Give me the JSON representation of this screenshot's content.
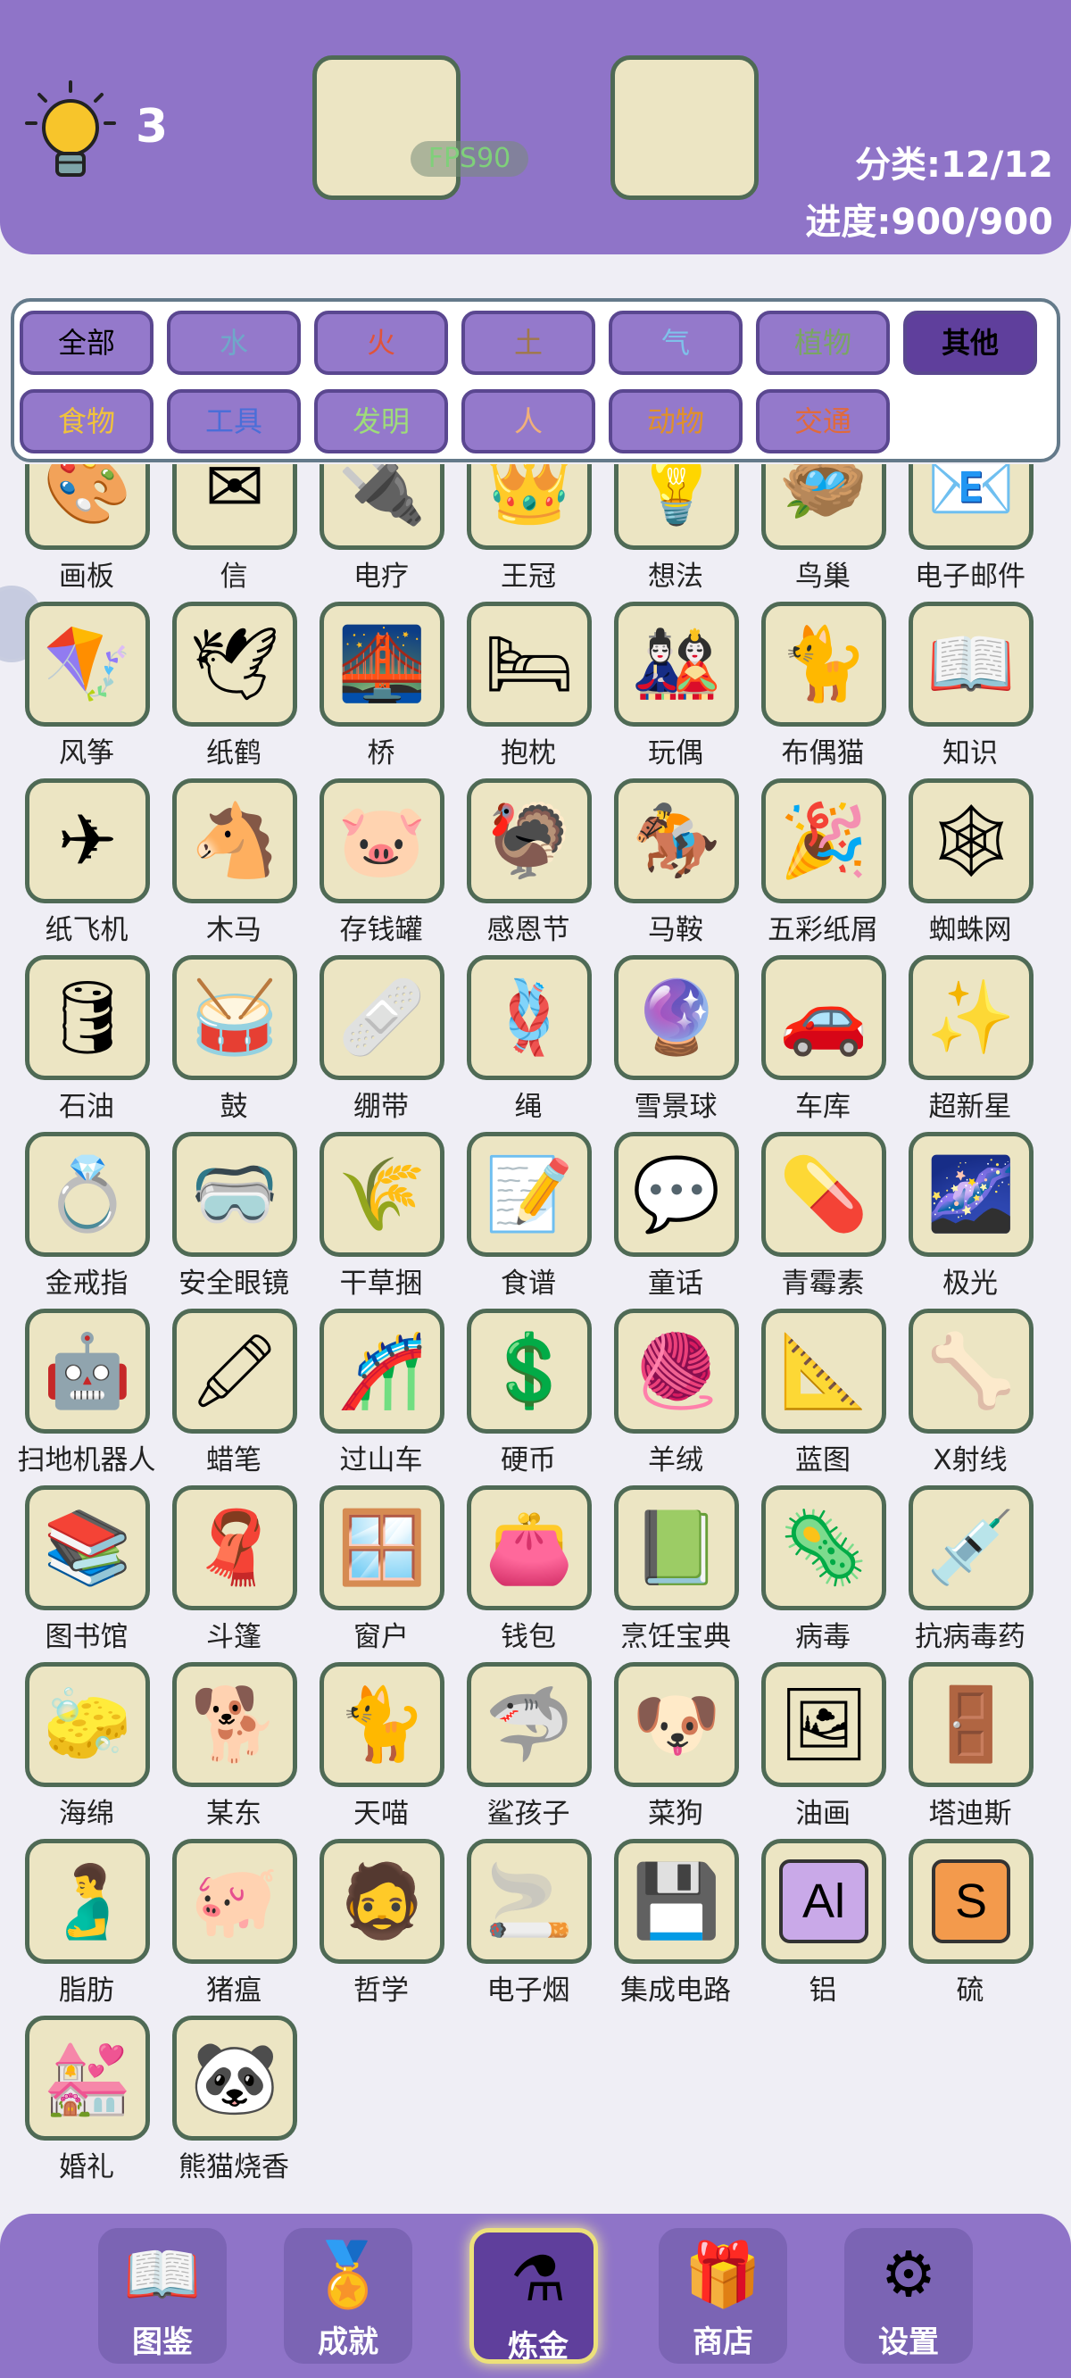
{
  "header": {
    "hint_count": "3",
    "fps": "FPS90",
    "category_stat": "分类:12/12",
    "progress_stat": "进度:900/900"
  },
  "filters": [
    {
      "label": "全部",
      "color": "#000000"
    },
    {
      "label": "水",
      "color": "#6fa8c9"
    },
    {
      "label": "火",
      "color": "#e0533a"
    },
    {
      "label": "土",
      "color": "#a0784a"
    },
    {
      "label": "气",
      "color": "#7fc1ea"
    },
    {
      "label": "植物",
      "color": "#7aa564"
    },
    {
      "label": "其他",
      "color": "#000000",
      "selected": true
    },
    {
      "label": "食物",
      "color": "#f0c23c"
    },
    {
      "label": "工具",
      "color": "#4a6ed8"
    },
    {
      "label": "发明",
      "color": "#9fdc7a"
    },
    {
      "label": "人",
      "color": "#f0b07a"
    },
    {
      "label": "动物",
      "color": "#e0902a"
    },
    {
      "label": "交通",
      "color": "#e06a3c"
    }
  ],
  "items": [
    {
      "name": "画板",
      "icon": "🎨"
    },
    {
      "name": "信",
      "icon": "✉"
    },
    {
      "name": "电疗",
      "icon": "🔌"
    },
    {
      "name": "王冠",
      "icon": "👑"
    },
    {
      "name": "想法",
      "icon": "💡"
    },
    {
      "name": "鸟巢",
      "icon": "🪺"
    },
    {
      "name": "电子邮件",
      "icon": "📧"
    },
    {
      "name": "风筝",
      "icon": "🪁"
    },
    {
      "name": "纸鹤",
      "icon": "🕊"
    },
    {
      "name": "桥",
      "icon": "🌉"
    },
    {
      "name": "抱枕",
      "icon": "🛏"
    },
    {
      "name": "玩偶",
      "icon": "🎎"
    },
    {
      "name": "布偶猫",
      "icon": "🐈"
    },
    {
      "name": "知识",
      "icon": "📖"
    },
    {
      "name": "纸飞机",
      "icon": "✈"
    },
    {
      "name": "木马",
      "icon": "🐴"
    },
    {
      "name": "存钱罐",
      "icon": "🐷"
    },
    {
      "name": "感恩节",
      "icon": "🦃"
    },
    {
      "name": "马鞍",
      "icon": "🏇"
    },
    {
      "name": "五彩纸屑",
      "icon": "🎉"
    },
    {
      "name": "蜘蛛网",
      "icon": "🕸"
    },
    {
      "name": "石油",
      "icon": "🛢"
    },
    {
      "name": "鼓",
      "icon": "🥁"
    },
    {
      "name": "绷带",
      "icon": "🩹"
    },
    {
      "name": "绳",
      "icon": "🪢"
    },
    {
      "name": "雪景球",
      "icon": "🔮"
    },
    {
      "name": "车库",
      "icon": "🚗"
    },
    {
      "name": "超新星",
      "icon": "✨"
    },
    {
      "name": "金戒指",
      "icon": "💍"
    },
    {
      "name": "安全眼镜",
      "icon": "🥽"
    },
    {
      "name": "干草捆",
      "icon": "🌾"
    },
    {
      "name": "食谱",
      "icon": "📝"
    },
    {
      "name": "童话",
      "icon": "💬"
    },
    {
      "name": "青霉素",
      "icon": "💊"
    },
    {
      "name": "极光",
      "icon": "🌌"
    },
    {
      "name": "扫地机器人",
      "icon": "🤖"
    },
    {
      "name": "蜡笔",
      "icon": "🖍"
    },
    {
      "name": "过山车",
      "icon": "🎢"
    },
    {
      "name": "硬币",
      "icon": "💲"
    },
    {
      "name": "羊绒",
      "icon": "🧶"
    },
    {
      "name": "蓝图",
      "icon": "📐"
    },
    {
      "name": "X射线",
      "icon": "🦴"
    },
    {
      "name": "图书馆",
      "icon": "📚"
    },
    {
      "name": "斗篷",
      "icon": "🧣"
    },
    {
      "name": "窗户",
      "icon": "🪟"
    },
    {
      "name": "钱包",
      "icon": "👛"
    },
    {
      "name": "烹饪宝典",
      "icon": "📗"
    },
    {
      "name": "病毒",
      "icon": "🦠"
    },
    {
      "name": "抗病毒药",
      "icon": "💉"
    },
    {
      "name": "海绵",
      "icon": "🧽"
    },
    {
      "name": "某东",
      "icon": "🐕"
    },
    {
      "name": "天喵",
      "icon": "🐈"
    },
    {
      "name": "鲨孩子",
      "icon": "🦈"
    },
    {
      "name": "菜狗",
      "icon": "🐶"
    },
    {
      "name": "油画",
      "icon": "🖼"
    },
    {
      "name": "塔迪斯",
      "icon": "🚪"
    },
    {
      "name": "脂肪",
      "icon": "🫃"
    },
    {
      "name": "猪瘟",
      "icon": "🐖"
    },
    {
      "name": "哲学",
      "icon": "🧔"
    },
    {
      "name": "电子烟",
      "icon": "🚬"
    },
    {
      "name": "集成电路",
      "icon": "💾"
    },
    {
      "name": "铝",
      "icon": "Al"
    },
    {
      "name": "硫",
      "icon": "S"
    },
    {
      "name": "婚礼",
      "icon": "💒"
    },
    {
      "name": "熊猫烧香",
      "icon": "🐼"
    }
  ],
  "nav": [
    {
      "label": "图鉴",
      "icon": "📖"
    },
    {
      "label": "成就",
      "icon": "🏅"
    },
    {
      "label": "炼金",
      "icon": "⚗",
      "active": true
    },
    {
      "label": "商店",
      "icon": "🎁"
    },
    {
      "label": "设置",
      "icon": "⚙"
    }
  ]
}
